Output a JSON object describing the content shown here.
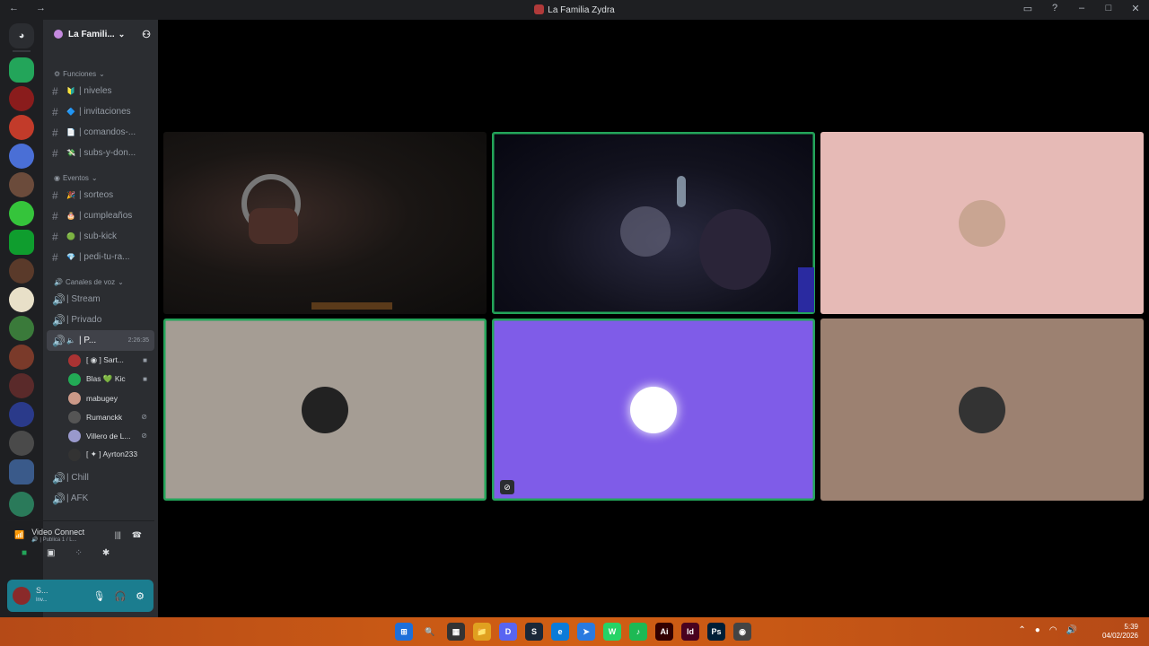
{
  "window": {
    "title": "La Familia Zydra",
    "nav": "← →"
  },
  "server": {
    "name": "La Famili...",
    "chevron": "⌄"
  },
  "categories": {
    "funciones": "Funciones",
    "eventos": "Eventos",
    "voz": "Canales de voz"
  },
  "text_channels": [
    {
      "emoji": "🔰",
      "name": "| niveles"
    },
    {
      "emoji": "🔷",
      "name": "| invitaciones"
    },
    {
      "emoji": "📄",
      "name": "| comandos-..."
    },
    {
      "emoji": "💸",
      "name": "| subs-y-don..."
    }
  ],
  "event_channels": [
    {
      "emoji": "🎉",
      "name": "| sorteos"
    },
    {
      "emoji": "🎂",
      "name": "| cumpleaños"
    },
    {
      "emoji": "🟢",
      "name": "| sub-kick"
    },
    {
      "emoji": "💎",
      "name": "| pedi-tu-ra..."
    }
  ],
  "voice_channels": [
    {
      "name": "| Stream"
    },
    {
      "name": "| Privado"
    },
    {
      "name": "| P...",
      "timer": "2:26:35",
      "active": true
    }
  ],
  "members": [
    {
      "name": "[ ◉ ] Sart...",
      "color": "#a33"
    },
    {
      "name": "Blas 💚 Kic",
      "color": "#2a5"
    },
    {
      "name": "mabugey",
      "color": "#c98"
    },
    {
      "name": "Rumanckk",
      "color": "#555"
    },
    {
      "name": "Villero de L...",
      "color": "#99c"
    },
    {
      "name": "[ ✦ ] Ayrton233",
      "color": "#333"
    }
  ],
  "more_voice": [
    {
      "name": "| Chill"
    },
    {
      "name": "| AFK"
    }
  ],
  "voice_status": {
    "title": "Video Connect",
    "sub": "🔊 | Publica 1 / L..."
  },
  "user": {
    "name": "S...",
    "status": "Inv..."
  },
  "tiles": [
    {
      "kind": "video-dark"
    },
    {
      "kind": "video-blue"
    },
    {
      "kind": "avatar",
      "bg": "#e6bab6",
      "av": "#c9a592"
    },
    {
      "kind": "avatar",
      "bg": "#a59d94",
      "av": "#222"
    },
    {
      "kind": "avatar",
      "bg": "#7f5ce8",
      "av": "#fff"
    },
    {
      "kind": "avatar",
      "bg": "#9c8171",
      "av": "#333"
    }
  ],
  "taskbar": {
    "icons": [
      "⊞",
      "🔍",
      "▦",
      "📁",
      "D",
      "S",
      "e",
      "➤",
      "W",
      "♪",
      "Ai",
      "Id",
      "Ps",
      "◉"
    ],
    "time": "5:39",
    "date": "04/02/2026"
  }
}
